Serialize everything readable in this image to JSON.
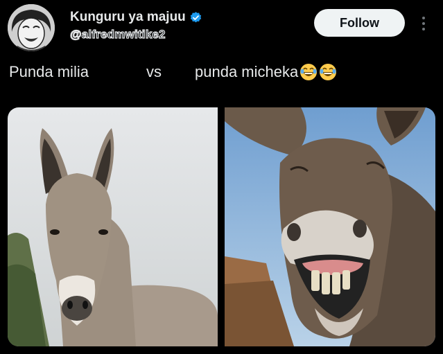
{
  "author": {
    "display_name": "Kunguru ya majuu",
    "handle": "@alfredmwitike2",
    "verified": true,
    "avatar_icon": "cartoon-face-avatar"
  },
  "actions": {
    "follow_label": "Follow",
    "more_icon": "vertical-ellipsis-icon"
  },
  "tweet": {
    "part1": "Punda milia",
    "part2": "vs",
    "part3": "punda micheka",
    "emoji": "😂😂"
  },
  "media": {
    "left_image": "donkey-front-portrait",
    "right_image": "laughing-donkey"
  },
  "colors": {
    "background": "#000000",
    "text": "#e7e9ea",
    "verified": "#1d9bf0",
    "follow_bg": "#eff3f4"
  }
}
